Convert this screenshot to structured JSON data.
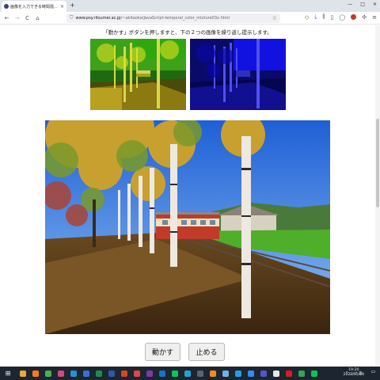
{
  "browser": {
    "tab_title": "画像を入力できる時間混色 tem",
    "close_glyph": "×",
    "new_tab_glyph": "+",
    "window_buttons": [
      "—",
      "□",
      "×"
    ],
    "url_host": "www.psy.ritsumei.ac.jp",
    "url_path": "/~akitaoka/JavaScript-temporal_color_mixture03x.html",
    "nav": {
      "back": "←",
      "forward": "→",
      "reload": "C",
      "home": "⌂"
    },
    "star_glyph": "☆",
    "menu_glyph": "≡"
  },
  "page": {
    "instruction": "「動かす」ボタンを押しますと、下の２つの画像を繰り返し提示します。",
    "play_label": "動かす",
    "stop_label": "止める"
  },
  "colors": {
    "taskbar": "#1c2530",
    "left_image_tint": "#e3e020",
    "right_image_tint": "#1a1ae6",
    "train_red": "#c23a2a",
    "train_cream": "#f0e2c0"
  },
  "taskbar": {
    "start_glyph": "⊞",
    "apps": [
      {
        "name": "file-explorer",
        "color": "#e0b030"
      },
      {
        "name": "firefox",
        "color": "#ff7a1a"
      },
      {
        "name": "chrome",
        "color": "#4caf50"
      },
      {
        "name": "paint",
        "color": "#d04a80"
      },
      {
        "name": "edge",
        "color": "#2b8fd6"
      },
      {
        "name": "photos",
        "color": "#3b6fd8"
      },
      {
        "name": "excel",
        "color": "#1f8a4c"
      },
      {
        "name": "word",
        "color": "#2a5caa"
      },
      {
        "name": "powerpoint",
        "color": "#d24726"
      },
      {
        "name": "media-player",
        "color": "#e0454a"
      },
      {
        "name": "onenote",
        "color": "#7a3aa8"
      },
      {
        "name": "outlook",
        "color": "#1a72c9"
      },
      {
        "name": "line",
        "color": "#06c755"
      },
      {
        "name": "photoshop",
        "color": "#26a0d8"
      },
      {
        "name": "calculator",
        "color": "#5a6470"
      },
      {
        "name": "vlc",
        "color": "#f08a24"
      },
      {
        "name": "notepad",
        "color": "#6fb3e0"
      },
      {
        "name": "skype",
        "color": "#1ea0e6"
      },
      {
        "name": "zoom",
        "color": "#2d8cff"
      },
      {
        "name": "teams",
        "color": "#5059c9"
      },
      {
        "name": "security",
        "color": "#e6e6e6"
      },
      {
        "name": "acrobat",
        "color": "#d61c1c"
      },
      {
        "name": "maps",
        "color": "#3aa05a"
      },
      {
        "name": "line2",
        "color": "#06c755"
      }
    ],
    "tray_icons": "^ ▭ ♪ あ",
    "time": "19:20",
    "date": "2022/01/24",
    "notification_glyph": "▭"
  }
}
